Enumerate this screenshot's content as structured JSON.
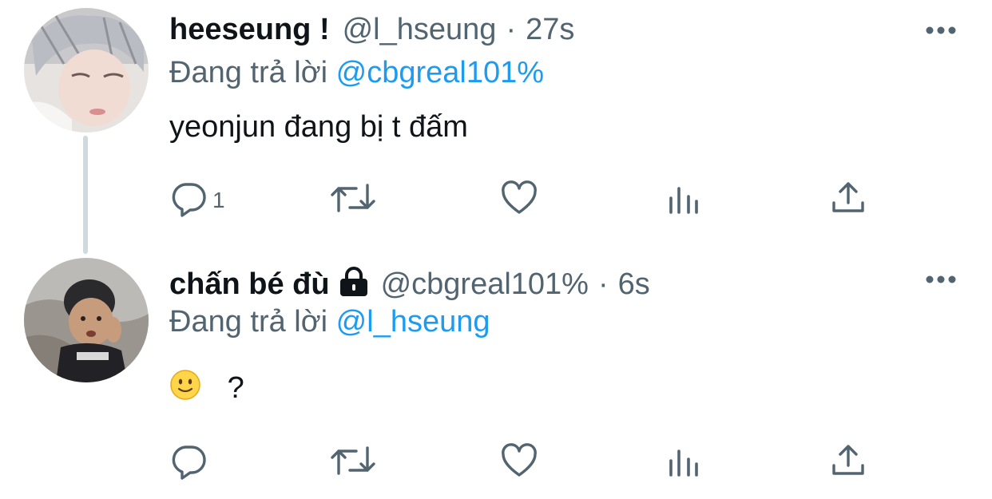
{
  "tweets": [
    {
      "display_name": "heeseung !",
      "handle": "@l_hseung",
      "separator": "·",
      "time": "27s",
      "reply_prefix": "Đang trả lời",
      "reply_to": "@cbgreal101%",
      "text": "yeonjun đang bị t đấm",
      "reply_count": "1",
      "locked": false
    },
    {
      "display_name": "chấn bé đù",
      "handle": "@cbgreal101%",
      "separator": "·",
      "time": "6s",
      "reply_prefix": "Đang trả lời",
      "reply_to": "@l_hseung",
      "text": "?",
      "emoji": "slightly-smiling-face",
      "reply_count": "",
      "locked": true
    }
  ],
  "icons": {
    "reply": "reply-icon",
    "retweet": "retweet-icon",
    "like": "heart-icon",
    "views": "analytics-icon",
    "share": "share-icon",
    "more": "more-dots-icon",
    "lock": "lock-icon"
  },
  "colors": {
    "text": "#0f1419",
    "secondary": "#536471",
    "link": "#1d9bf0",
    "thread_line": "#cfd9de"
  }
}
